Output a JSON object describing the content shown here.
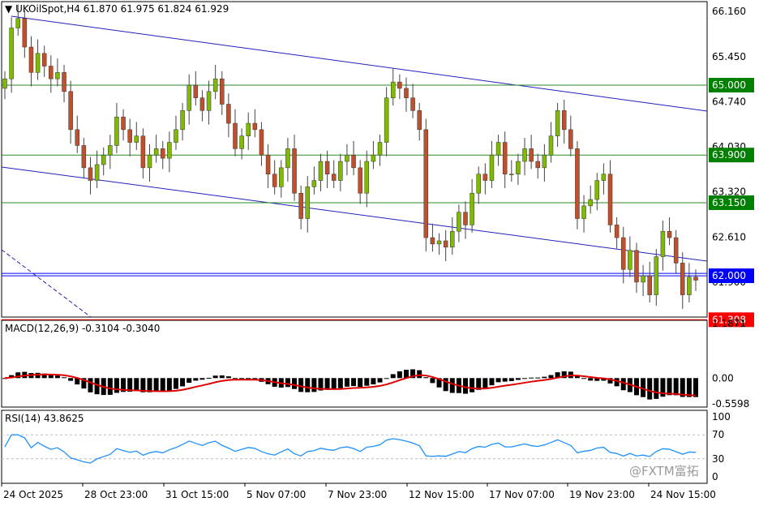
{
  "header": {
    "symbol": "UKOilSpot,H4",
    "open": "61.870",
    "high": "61.975",
    "low": "61.824",
    "close": "61.929"
  },
  "watermark": "@FXTM富拓",
  "colors": {
    "bull_body": "#7fba00",
    "bear_body": "#c0502b",
    "wick": "#444444",
    "channel": "#2020c0",
    "support_resistance": "#2a8a2a",
    "level_red": "#e00000",
    "level_blue": "#0000ff",
    "macd_signal": "#e00000",
    "macd_hist": "#000000",
    "rsi_line": "#1e90ff",
    "tag_green": "#008000",
    "tag_blue": "#0000ff",
    "tag_red": "#ff0000"
  },
  "chart_data": [
    {
      "type": "candlestick",
      "name": "UKOilSpot,H4",
      "y_ticks": [
        "66.160",
        "65.450",
        "64.740",
        "64.030",
        "63.320",
        "62.610",
        "61.900"
      ],
      "ylim": [
        61.35,
        66.2
      ],
      "x_ticks": [
        "24 Oct 2025",
        "28 Oct 23:00",
        "31 Oct 15:00",
        "5 Nov 07:00",
        "7 Nov 23:00",
        "12 Nov 15:00",
        "17 Nov 07:00",
        "19 Nov 23:00",
        "24 Nov 15:00"
      ],
      "level_tags": [
        {
          "label": "65.000",
          "value": 65.0,
          "color": "green"
        },
        {
          "label": "63.900",
          "value": 63.9,
          "color": "green"
        },
        {
          "label": "63.150",
          "value": 63.15,
          "color": "green"
        },
        {
          "label": "62.000",
          "value": 62.0,
          "color": "blue"
        },
        {
          "label": "61.308",
          "value": 61.308,
          "color": "red"
        }
      ],
      "closes": [
        65.1,
        65.9,
        66.05,
        65.6,
        65.2,
        65.5,
        65.3,
        65.1,
        65.2,
        64.9,
        64.3,
        64.05,
        63.7,
        63.5,
        63.75,
        63.9,
        64.05,
        64.5,
        64.3,
        64.1,
        64.2,
        63.7,
        63.9,
        64.0,
        63.85,
        64.1,
        64.3,
        64.6,
        65.0,
        64.8,
        64.6,
        64.9,
        65.1,
        64.7,
        64.4,
        64.0,
        64.2,
        64.4,
        64.3,
        63.9,
        63.6,
        63.4,
        63.7,
        64.0,
        63.3,
        62.9,
        63.4,
        63.5,
        63.8,
        63.6,
        63.5,
        63.8,
        63.9,
        63.7,
        63.3,
        63.8,
        63.9,
        64.1,
        64.8,
        65.05,
        64.95,
        64.8,
        64.6,
        64.3,
        62.6,
        62.5,
        62.55,
        62.45,
        62.7,
        63.0,
        62.8,
        63.3,
        63.6,
        63.5,
        63.9,
        64.1,
        63.6,
        63.6,
        63.8,
        64.0,
        63.8,
        63.7,
        63.9,
        64.2,
        64.6,
        64.3,
        64.0,
        62.9,
        63.1,
        63.2,
        63.5,
        63.6,
        62.8,
        62.6,
        62.1,
        62.4,
        61.9,
        62.0,
        61.7,
        62.3,
        62.7,
        62.6,
        62.2,
        61.7,
        61.98,
        61.93
      ],
      "indicator_windows": [
        {
          "title": "MACD(12,26,9) -0.3104 -0.3040",
          "y_ticks": [
            "1.1871",
            "0.00",
            "-0.5598"
          ]
        },
        {
          "title": "RSI(14) 43.8625",
          "y_ticks": [
            "100",
            "70",
            "30",
            "0"
          ]
        }
      ]
    }
  ]
}
